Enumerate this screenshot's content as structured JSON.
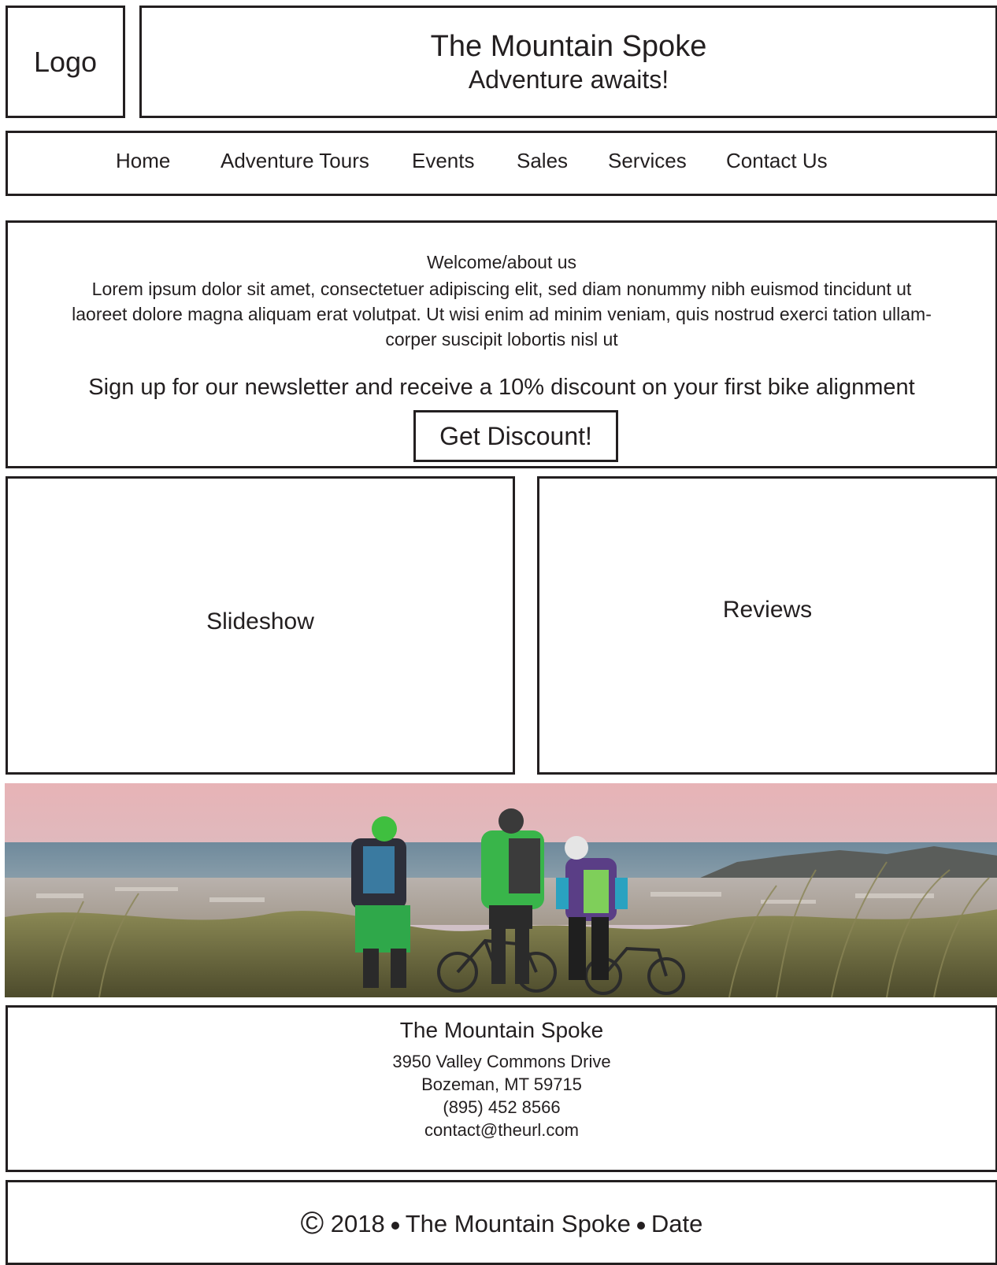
{
  "header": {
    "logo_text": "Logo",
    "site_title": "The Mountain Spoke",
    "tagline": "Adventure awaits!"
  },
  "nav": {
    "items": [
      {
        "label": "Home"
      },
      {
        "label": "Adventure Tours"
      },
      {
        "label": "Events"
      },
      {
        "label": "Sales"
      },
      {
        "label": "Services"
      },
      {
        "label": "Contact Us"
      }
    ]
  },
  "welcome": {
    "heading": "Welcome/about us",
    "body_line1": "Lorem ipsum dolor sit amet, consectetuer adipiscing elit, sed diam nonummy nibh euismod tincidunt ut",
    "body_line2": "laoreet dolore magna aliquam erat volutpat. Ut wisi enim ad minim veniam, quis nostrud exerci tation ullam-",
    "body_line3": "corper suscipit lobortis nisl ut",
    "newsletter_text": "Sign up for our newsletter and receive a 10% discount on your first bike alignment",
    "discount_button": "Get Discount!"
  },
  "slideshow": {
    "label": "Slideshow"
  },
  "reviews": {
    "label": "Reviews"
  },
  "contact": {
    "name": "The Mountain Spoke",
    "address1": "3950 Valley Commons Drive",
    "address2": "Bozeman, MT 59715",
    "phone": "(895) 452 8566",
    "email": "contact@theurl.com"
  },
  "footer": {
    "copyright_symbol": "©",
    "year": "2018",
    "company": "The Mountain Spoke",
    "date_label": "Date"
  },
  "colors": {
    "border": "#231f20",
    "sky_top": "#e9b5b7",
    "sea": "#5f7f93",
    "grass": "#7f8047"
  }
}
